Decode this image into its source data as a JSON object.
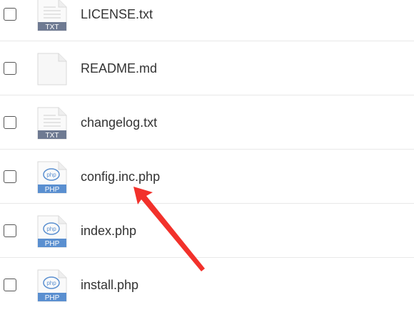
{
  "files": [
    {
      "name": "LICENSE.txt",
      "icon": "txt-file-icon",
      "badge": "TXT"
    },
    {
      "name": "README.md",
      "icon": "generic-file-icon",
      "badge": ""
    },
    {
      "name": "changelog.txt",
      "icon": "txt-file-icon",
      "badge": "TXT"
    },
    {
      "name": "config.inc.php",
      "icon": "php-file-icon",
      "badge": "PHP",
      "logo": "php"
    },
    {
      "name": "index.php",
      "icon": "php-file-icon",
      "badge": "PHP",
      "logo": "php"
    },
    {
      "name": "install.php",
      "icon": "php-file-icon",
      "badge": "PHP",
      "logo": "php"
    }
  ],
  "colors": {
    "txt_badge": "#6e7a92",
    "php_badge": "#5a8fd0",
    "annotation_arrow": "#f2312b"
  }
}
